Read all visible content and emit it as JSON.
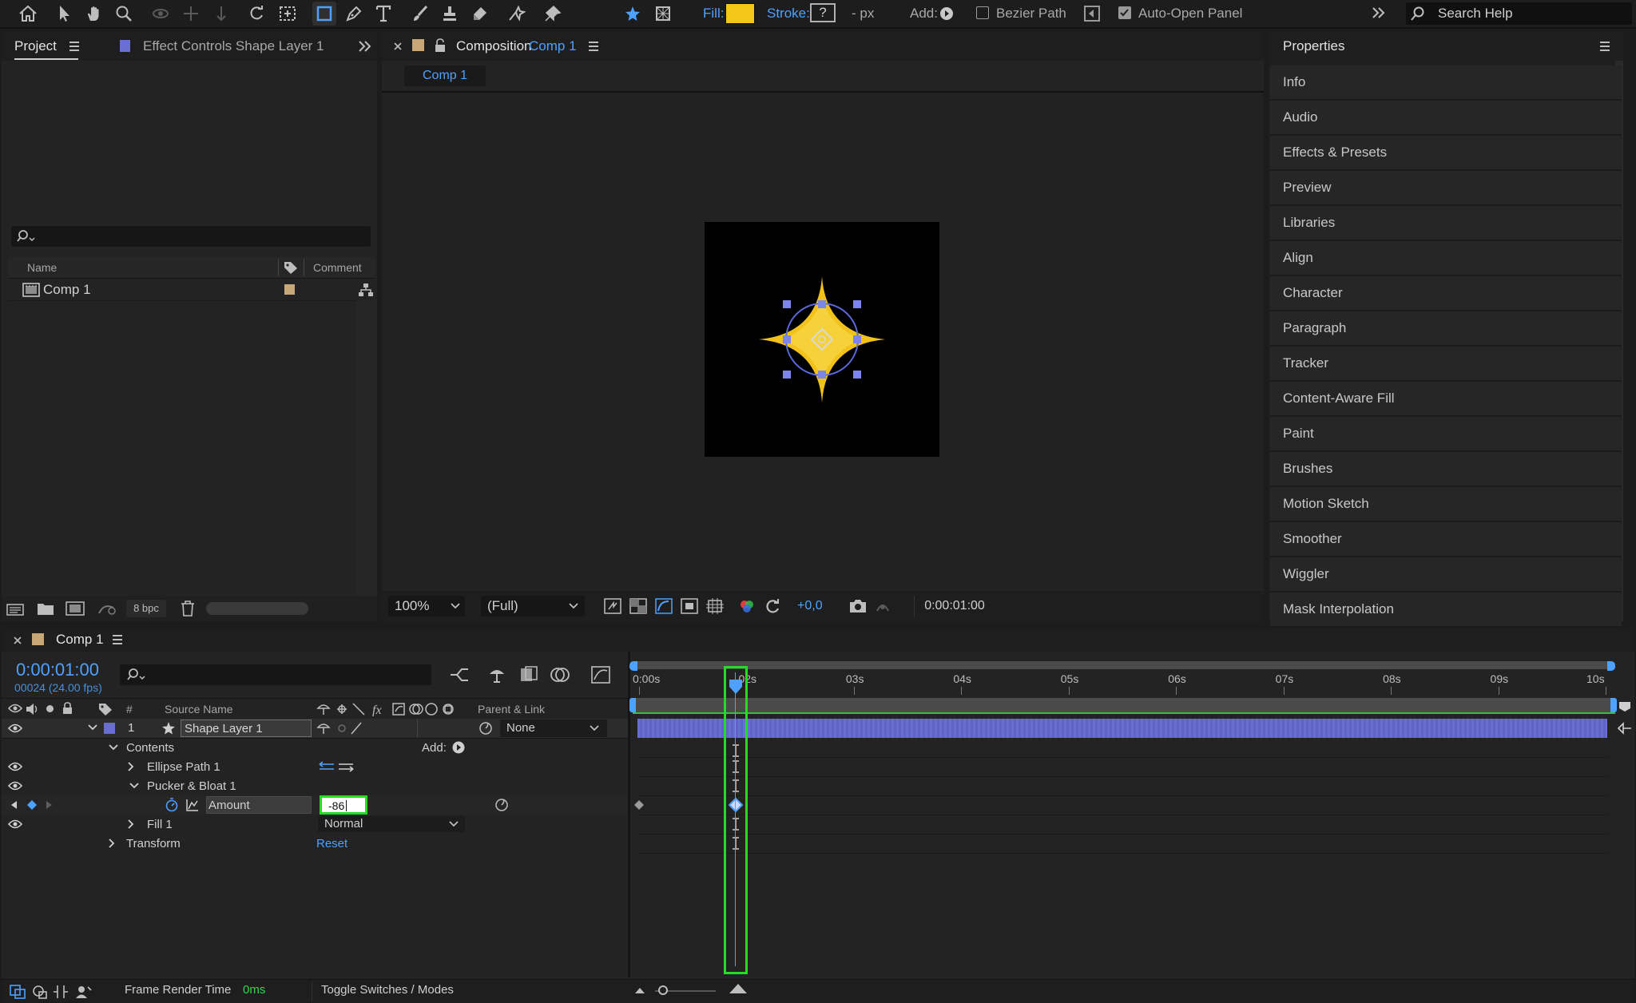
{
  "toolbar": {
    "fill_label": "Fill:",
    "fill_color": "#f5c518",
    "stroke_label": "Stroke:",
    "stroke_value": "?",
    "stroke_px": "- px",
    "add_label": "Add:",
    "bezier_path": "Bezier Path",
    "auto_open_panel": "Auto-Open Panel",
    "search_help": "Search Help"
  },
  "project": {
    "tab": "Project",
    "effect_controls_tab": "Effect Controls Shape Layer 1",
    "col_name": "Name",
    "col_comment": "Comment",
    "item": "Comp 1",
    "item_color": "#c9a878",
    "bpc": "8 bpc"
  },
  "composition": {
    "tab_prefix": "Composition",
    "tab_name": "Comp 1",
    "subtab": "Comp 1",
    "zoom": "100%",
    "resolution": "(Full)",
    "exposure": "+0,0",
    "timecode": "0:00:01:00"
  },
  "properties": {
    "title": "Properties",
    "items": [
      "Info",
      "Audio",
      "Effects & Presets",
      "Preview",
      "Libraries",
      "Align",
      "Character",
      "Paragraph",
      "Tracker",
      "Content-Aware Fill",
      "Paint",
      "Brushes",
      "Motion Sketch",
      "Smoother",
      "Wiggler",
      "Mask Interpolation"
    ]
  },
  "timeline": {
    "tab": "Comp 1",
    "current_time": "0:00:01:00",
    "frame_info": "00024 (24.00 fps)",
    "col_num": "#",
    "col_source": "Source Name",
    "col_parent": "Parent & Link",
    "layer_num": "1",
    "layer_name": "Shape Layer 1",
    "parent": "None",
    "contents": "Contents",
    "add": "Add:",
    "ellipse": "Ellipse Path 1",
    "pucker": "Pucker & Bloat 1",
    "amount": "Amount",
    "amount_value": "-86",
    "fill": "Fill 1",
    "blend_mode": "Normal",
    "transform": "Transform",
    "reset": "Reset",
    "ruler": [
      "0:00s",
      "02s",
      "03s",
      "04s",
      "05s",
      "06s",
      "07s",
      "08s",
      "09s",
      "10s"
    ],
    "frame_render_label": "Frame Render Time",
    "frame_render_value": "0ms",
    "toggle": "Toggle Switches / Modes",
    "layer_bar_color": "#6a6fcf",
    "highlight_color": "#22dd22"
  }
}
